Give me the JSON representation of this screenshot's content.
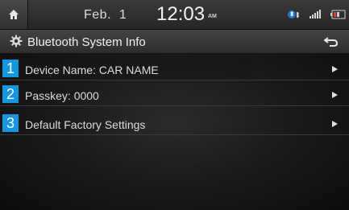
{
  "status_bar": {
    "home_icon": "home-icon",
    "date": "Feb.  1",
    "time": "12:03",
    "ampm": "AM",
    "indicators": [
      "bluetooth-phone-icon",
      "signal-strength-icon",
      "battery-icon"
    ]
  },
  "title_bar": {
    "icon": "gear-icon",
    "title": "Bluetooth System Info",
    "back_icon": "back-arrow-icon"
  },
  "menu": {
    "items": [
      {
        "number": "1",
        "label": "Device Name: CAR NAME",
        "icon": "arrow-right-icon"
      },
      {
        "number": "2",
        "label": "Passkey: 0000",
        "icon": "arrow-right-icon"
      },
      {
        "number": "3",
        "label": "Default Factory Settings",
        "icon": "arrow-right-icon"
      }
    ]
  },
  "colors": {
    "badge": "#1496e0",
    "background": "#1a1a1a",
    "text": "#dcdcdc"
  }
}
